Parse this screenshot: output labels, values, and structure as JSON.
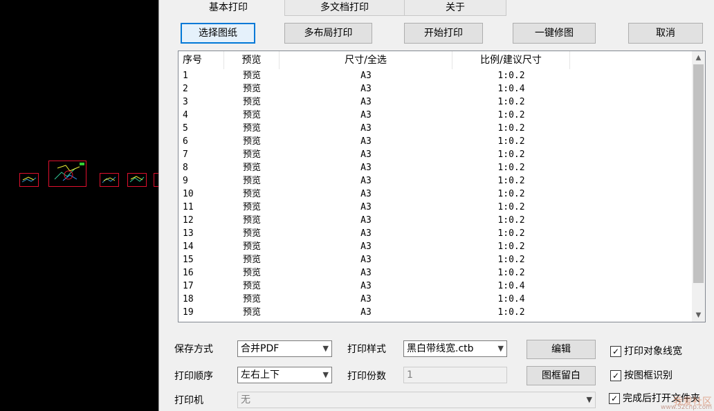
{
  "tabs": [
    "基本打印",
    "多文档打印",
    "关于"
  ],
  "buttons": {
    "select": "选择图纸",
    "multi_layout": "多布局打印",
    "start": "开始打印",
    "fix": "一键修图",
    "cancel": "取消",
    "edit": "编辑",
    "frame_margin": "图框留白"
  },
  "table": {
    "headers": [
      "序号",
      "预览",
      "尺寸/全选",
      "比例/建议尺寸"
    ],
    "rows": [
      [
        "1",
        "预览",
        "A3",
        "1:0.2"
      ],
      [
        "2",
        "预览",
        "A3",
        "1:0.4"
      ],
      [
        "3",
        "预览",
        "A3",
        "1:0.2"
      ],
      [
        "4",
        "预览",
        "A3",
        "1:0.2"
      ],
      [
        "5",
        "预览",
        "A3",
        "1:0.2"
      ],
      [
        "6",
        "预览",
        "A3",
        "1:0.2"
      ],
      [
        "7",
        "预览",
        "A3",
        "1:0.2"
      ],
      [
        "8",
        "预览",
        "A3",
        "1:0.2"
      ],
      [
        "9",
        "预览",
        "A3",
        "1:0.2"
      ],
      [
        "10",
        "预览",
        "A3",
        "1:0.2"
      ],
      [
        "11",
        "预览",
        "A3",
        "1:0.2"
      ],
      [
        "12",
        "预览",
        "A3",
        "1:0.2"
      ],
      [
        "13",
        "预览",
        "A3",
        "1:0.2"
      ],
      [
        "14",
        "预览",
        "A3",
        "1:0.2"
      ],
      [
        "15",
        "预览",
        "A3",
        "1:0.2"
      ],
      [
        "16",
        "预览",
        "A3",
        "1:0.2"
      ],
      [
        "17",
        "预览",
        "A3",
        "1:0.4"
      ],
      [
        "18",
        "预览",
        "A3",
        "1:0.4"
      ],
      [
        "19",
        "预览",
        "A3",
        "1:0.2"
      ]
    ]
  },
  "settings": {
    "save_mode_label": "保存方式",
    "save_mode_value": "合并PDF",
    "print_style_label": "打印样式",
    "print_style_value": "黑白带线宽.ctb",
    "print_order_label": "打印顺序",
    "print_order_value": "左右上下",
    "copies_label": "打印份数",
    "copies_value": "1",
    "printer_label": "打印机",
    "printer_value": "无"
  },
  "checkboxes": [
    {
      "label": "打印对象线宽",
      "checked": true
    },
    {
      "label": "按图框识别",
      "checked": true
    },
    {
      "label": "完成后打开文件夹",
      "checked": true
    }
  ],
  "watermark": {
    "text": "我爱社区",
    "sub": "www.52cnp.com"
  },
  "colors": {
    "frame": "#e0102e",
    "accent": "#0078d7"
  }
}
